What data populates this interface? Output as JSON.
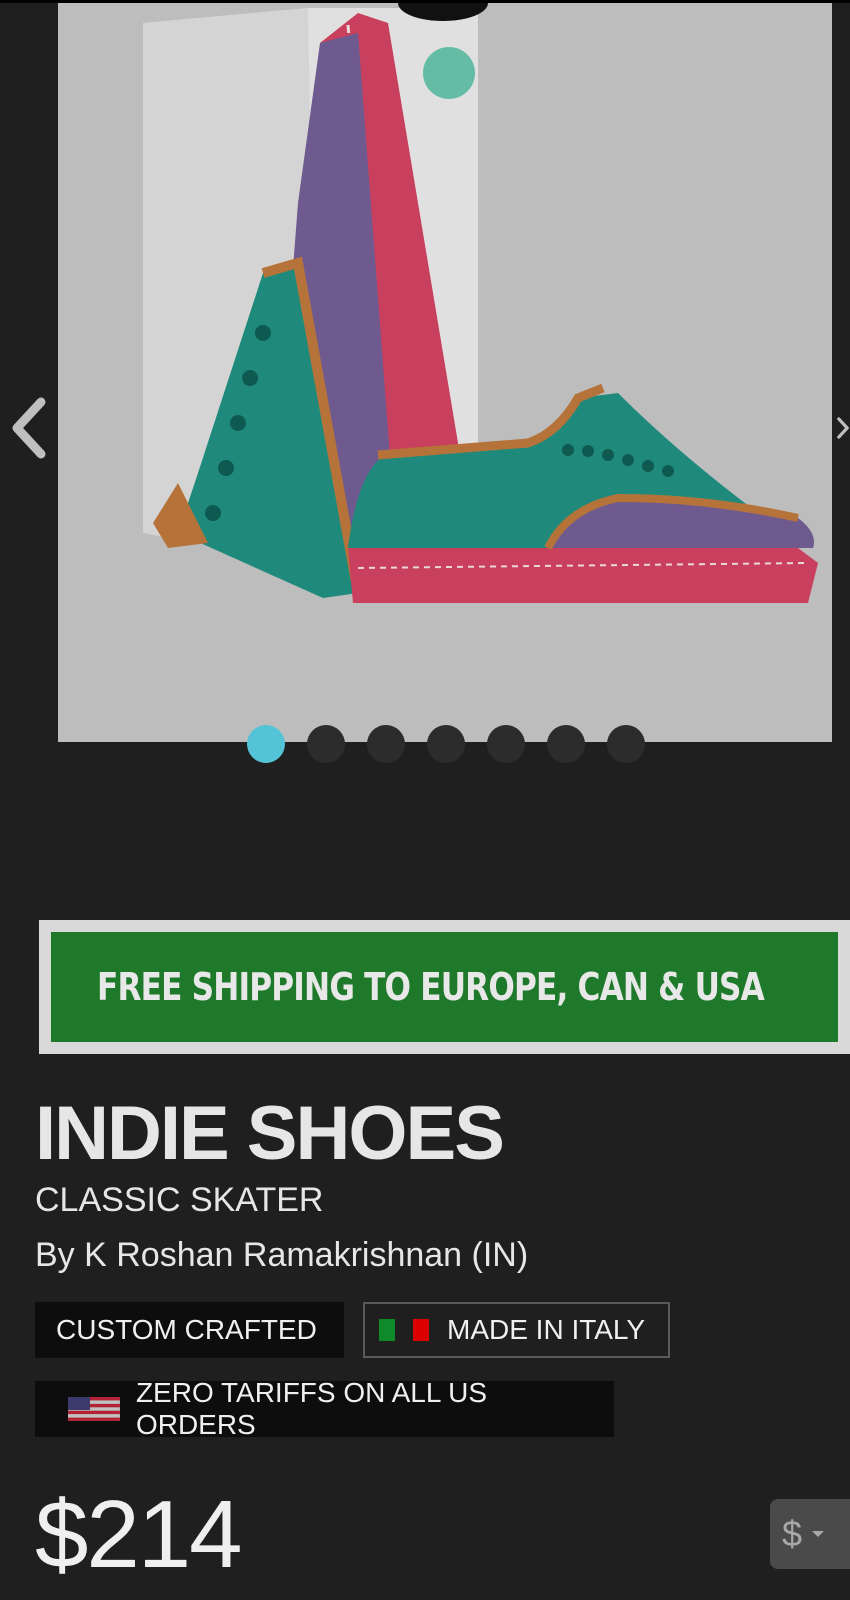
{
  "carousel": {
    "slide_count": 7,
    "active_index": 0,
    "image_alt": "Product image: two-tone skater shoes with box",
    "colors": {
      "upper_teal": "#1f8a7c",
      "upper_purple": "#6e5a8f",
      "sole_pink": "#c8405e",
      "trim_tan": "#b5733a",
      "active_dot": "#55c3d6"
    }
  },
  "shipping_banner": {
    "text": "FREE SHIPPING TO EUROPE, CAN & USA",
    "icon": "airplane-icon",
    "colors": {
      "background": "#1e7a2a",
      "border": "#d9d9d9"
    }
  },
  "product": {
    "brand": "INDIE SHOES",
    "model": "CLASSIC SKATER",
    "designer": "By K Roshan Ramakrishnan (IN)"
  },
  "badges": {
    "custom": "CUSTOM CRAFTED",
    "italy": "MADE IN ITALY",
    "tariffs": "ZERO TARIFFS ON ALL US ORDERS"
  },
  "price": {
    "amount": "$214",
    "currency_symbol": "$"
  }
}
